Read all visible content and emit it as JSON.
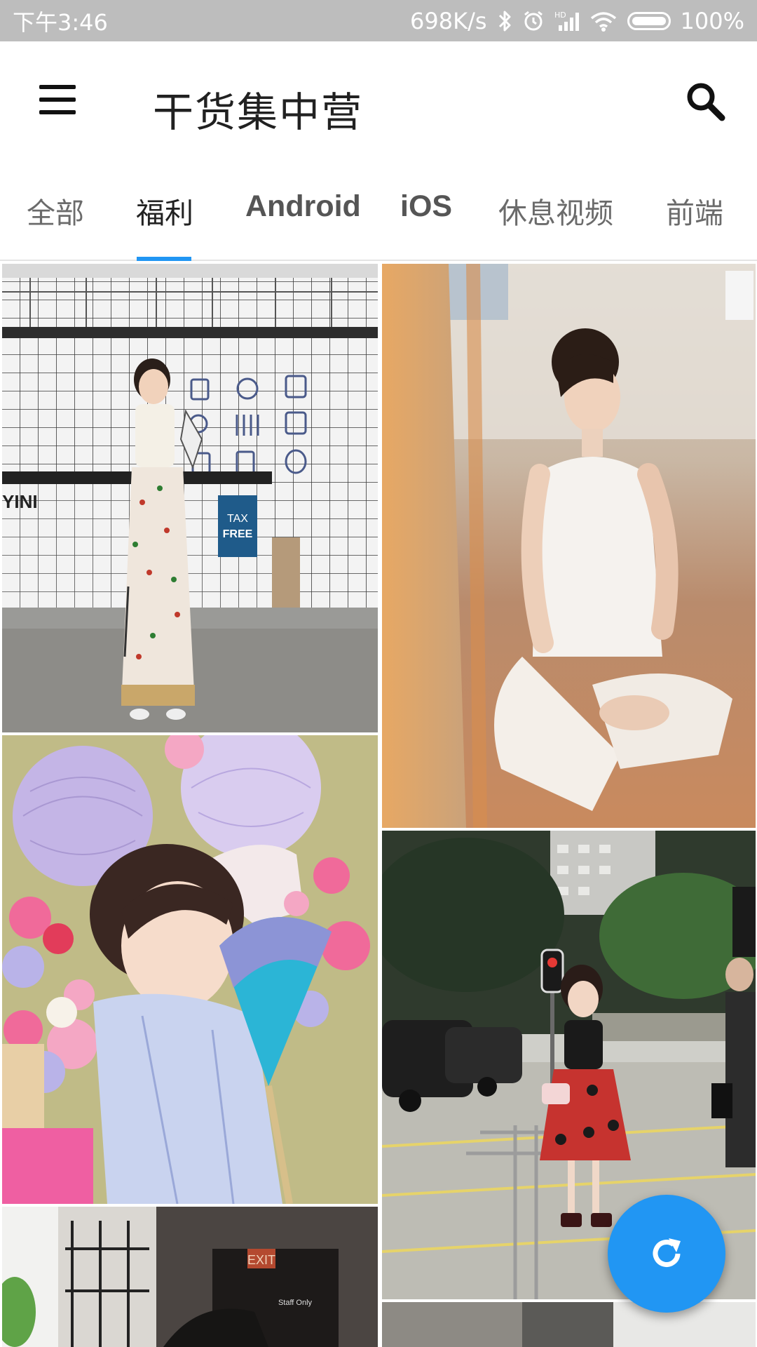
{
  "status_bar": {
    "time": "下午3:46",
    "network_speed": "698K/s",
    "battery": "100%",
    "icons": [
      "bluetooth-icon",
      "alarm-icon",
      "hd-signal-icon",
      "wifi-icon",
      "battery-icon"
    ]
  },
  "toolbar": {
    "title": "干货集中营",
    "menu_icon": "hamburger-menu-icon",
    "search_icon": "search-icon"
  },
  "tabs": [
    {
      "label": "全部"
    },
    {
      "label": "福利"
    },
    {
      "label": "Android"
    },
    {
      "label": "iOS"
    },
    {
      "label": "休息视频"
    },
    {
      "label": "前端"
    }
  ],
  "selected_tab": "福利",
  "gallery": {
    "photos": [
      {
        "description": "girl in patterned wide pants in white tiled shop",
        "sign_text": "TAX FREE"
      },
      {
        "description": "ballet dancer in white leotard sitting on floor"
      },
      {
        "description": "girl in yukata with paper fan and lanterns"
      },
      {
        "description": "girl in lolita dress on city street"
      },
      {
        "description": "man in cap under exit sign",
        "sign_text": "EXIT"
      },
      {
        "description": "partially visible photo"
      }
    ]
  },
  "fab": {
    "icon": "refresh-icon"
  },
  "colors": {
    "accent": "#2196f3",
    "status_bar": "#bdbdbd",
    "title_text": "#212121"
  }
}
